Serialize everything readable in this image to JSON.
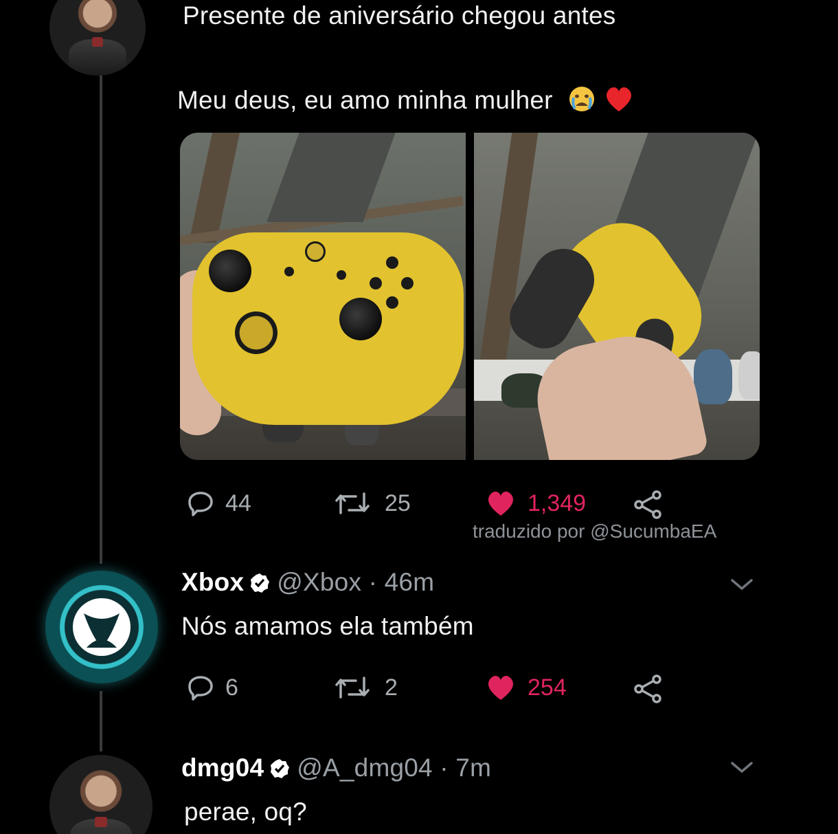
{
  "thread": {
    "main_tweet": {
      "line1": "Presente de aniversário chegou antes",
      "line2": "Meu deus, eu amo minha mulher",
      "stats": {
        "replies": "44",
        "retweets": "25",
        "likes": "1,349"
      },
      "translated_by": "traduzido por @SucumbaEA"
    },
    "reply_xbox": {
      "name": "Xbox",
      "meta": "@Xbox · 46m",
      "text": "Nós amamos ela também",
      "stats": {
        "replies": "6",
        "retweets": "2",
        "likes": "254"
      }
    },
    "reply_dmg": {
      "name": "dmg04",
      "meta": "@A_dmg04 · 7m",
      "text": "perae, oq?"
    }
  },
  "colors": {
    "background": "#000000",
    "like": "#e0245e",
    "verified": "#ffffff",
    "muted": "#9aa0a6",
    "xbox_accent": "#34c0c8",
    "controller_yellow": "#e2c22e"
  },
  "icons": [
    "reply-icon",
    "retweet-icon",
    "heart-icon",
    "share-icon",
    "verified-icon",
    "chevron-down-icon",
    "crying-face-emoji",
    "red-heart-emoji",
    "xbox-logo"
  ]
}
